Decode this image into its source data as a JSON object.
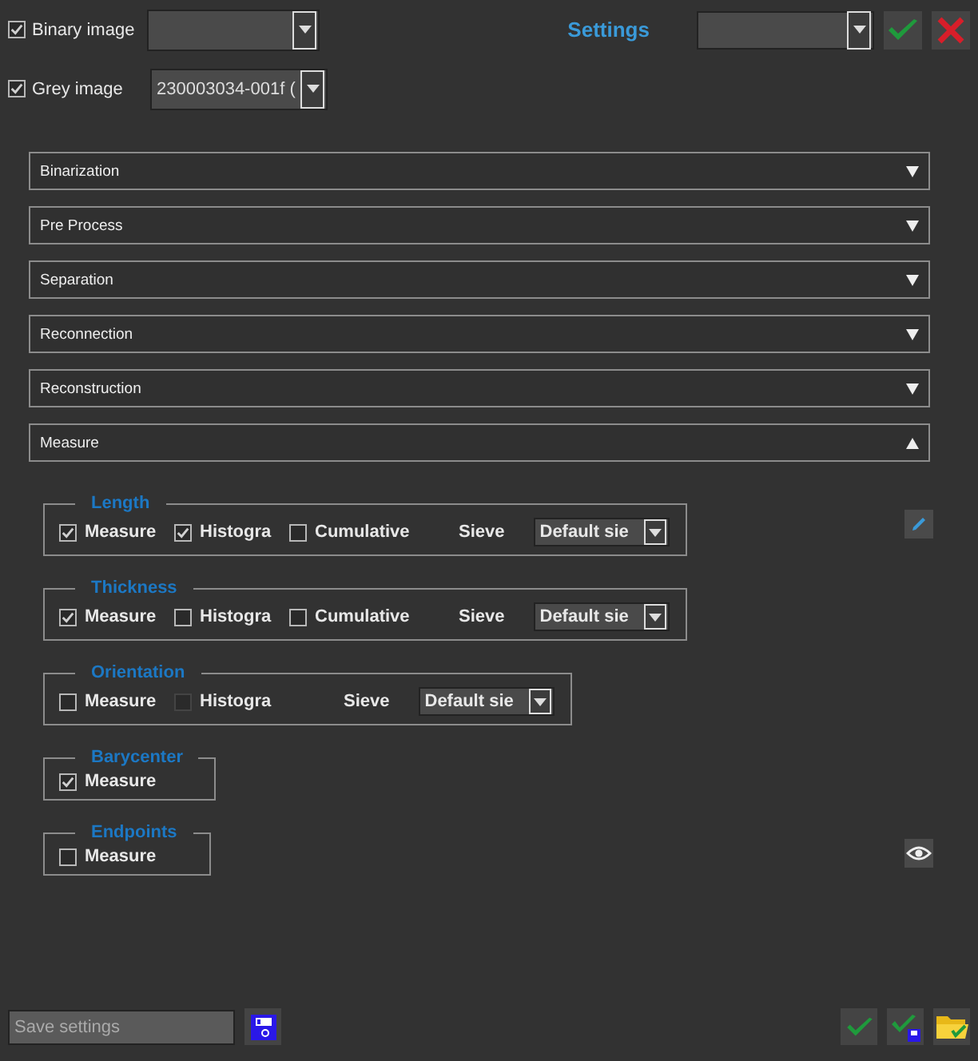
{
  "images": [
    {
      "label": "Binary image",
      "checked": true
    },
    {
      "label": "Grey image",
      "checked": true,
      "value": "230003034-001f ("
    }
  ],
  "title": "Settings",
  "sections": [
    {
      "label": "Binarization",
      "expanded": false
    },
    {
      "label": "Pre Process",
      "expanded": false
    },
    {
      "label": "Separation",
      "expanded": false
    },
    {
      "label": "Reconnection",
      "expanded": false
    },
    {
      "label": "Reconstruction",
      "expanded": false
    },
    {
      "label": "Measure",
      "expanded": true
    }
  ],
  "measure_groups": [
    {
      "title": "Length",
      "items": [
        {
          "kind": "checkbox",
          "label": "Measure",
          "checked": true,
          "disabled": false
        },
        {
          "kind": "checkbox",
          "label": "Histogra",
          "checked": true,
          "disabled": false
        },
        {
          "kind": "checkbox",
          "label": "Cumulative",
          "checked": false,
          "disabled": false
        },
        {
          "kind": "sieve",
          "label": "Sieve",
          "value": "Default sie"
        }
      ]
    },
    {
      "title": "Thickness",
      "items": [
        {
          "kind": "checkbox",
          "label": "Measure",
          "checked": true,
          "disabled": false
        },
        {
          "kind": "checkbox",
          "label": "Histogra",
          "checked": false,
          "disabled": false
        },
        {
          "kind": "checkbox",
          "label": "Cumulative",
          "checked": false,
          "disabled": false
        },
        {
          "kind": "sieve",
          "label": "Sieve",
          "value": "Default sie"
        }
      ]
    },
    {
      "title": "Orientation",
      "items": [
        {
          "kind": "checkbox",
          "label": "Measure",
          "checked": false,
          "disabled": false
        },
        {
          "kind": "checkbox",
          "label": "Histogra",
          "checked": false,
          "disabled": true
        },
        {
          "kind": "sieve",
          "label": "Sieve",
          "value": "Default sie"
        }
      ]
    },
    {
      "title": "Barycenter",
      "items": [
        {
          "kind": "checkbox",
          "label": "Measure",
          "checked": true,
          "disabled": false
        }
      ]
    },
    {
      "title": "Endpoints",
      "items": [
        {
          "kind": "checkbox",
          "label": "Measure",
          "checked": false,
          "disabled": false
        }
      ]
    }
  ],
  "save": {
    "placeholder": "Save settings"
  }
}
